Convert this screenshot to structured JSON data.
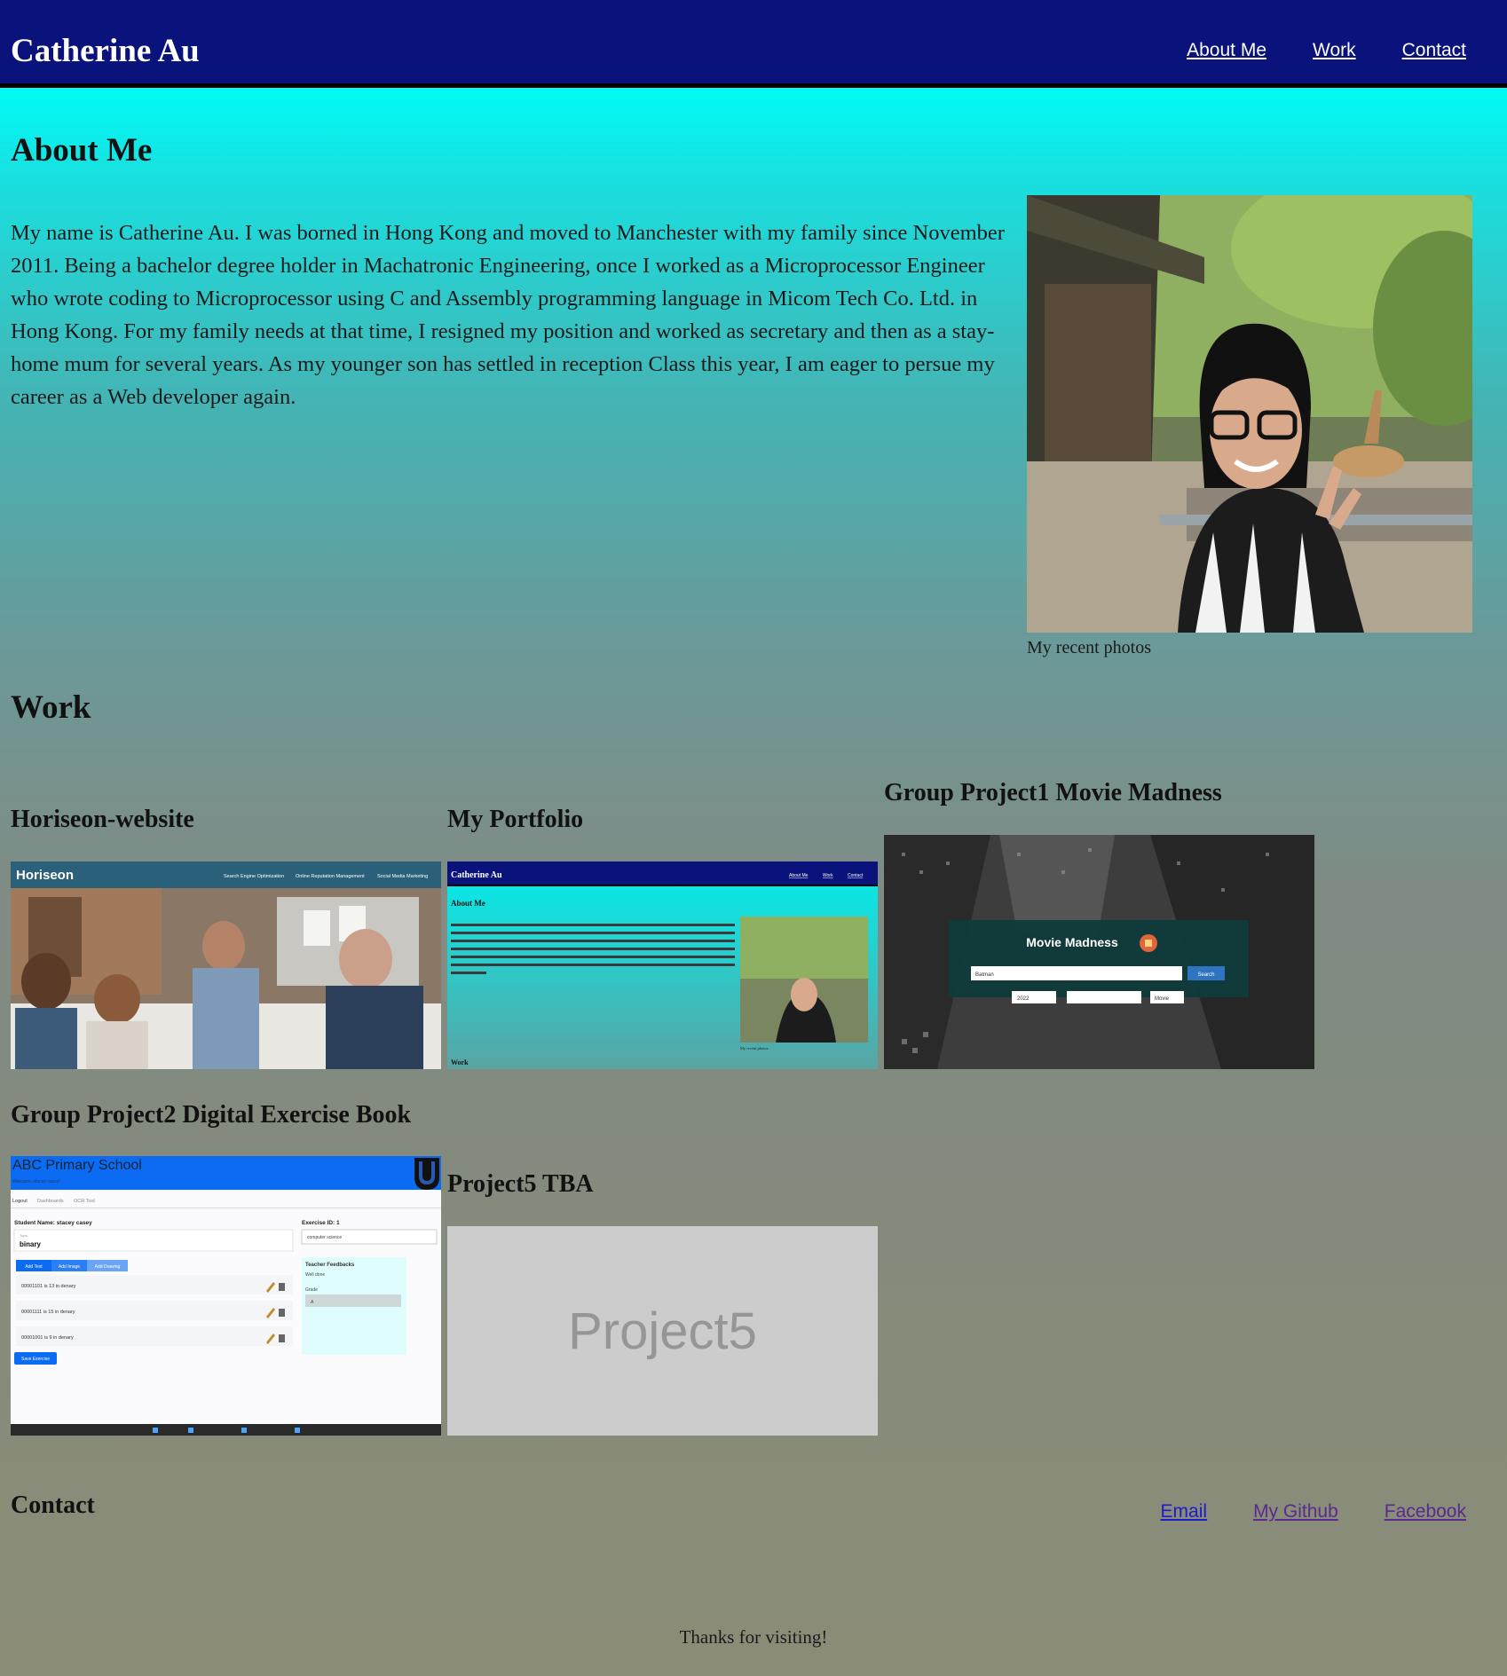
{
  "header": {
    "title": "Catherine Au",
    "nav": [
      {
        "label": "About Me"
      },
      {
        "label": "Work"
      },
      {
        "label": "Contact"
      }
    ]
  },
  "about": {
    "heading": "About Me",
    "text": "My name is Catherine Au. I was borned in Hong Kong and moved to Manchester with my family since November 2011. Being a bachelor degree holder in Machatronic Engineering, once I worked as a Microprocessor Engineer who wrote coding to Microprocessor using C and Assembly programming language in Micom Tech Co. Ltd. in Hong Kong. For my family needs at that time, I resigned my position and worked as secretary and then as a stay-home mum for several years. As my younger son has settled in reception Class this year, I am eager to persue my career as a Web developer again.",
    "photo_caption": "My recent photos"
  },
  "work": {
    "heading": "Work",
    "projects": [
      {
        "title": "Horiseon-website",
        "thumb": {
          "brand": "Horiseon",
          "nav": [
            "Search Engine Optimization",
            "Online Reputation Management",
            "Social Media Marketing"
          ]
        }
      },
      {
        "title": "My Portfolio",
        "thumb": {
          "brand": "Catherine Au",
          "nav": [
            "About Me",
            "Work",
            "Contact"
          ],
          "heading": "About Me",
          "caption": "My recent photos",
          "work": "Work"
        }
      },
      {
        "title": "Group Project1 Movie Madness",
        "thumb": {
          "app": "Movie Madness",
          "search_value": "Batman",
          "search_button": "Search",
          "year_value": "2022",
          "type_value": "Movie"
        }
      },
      {
        "title": "Group Project2 Digital Exercise Book",
        "thumb": {
          "school": "ABC Primary School",
          "welcome": "Welcome, stacey casey!",
          "tabs": [
            "Logout",
            "Dashboards",
            "OCR Tool"
          ],
          "student": "Student Name: stacey casey",
          "topic_label": "Topic",
          "topic": "binary",
          "exercise": "Exercise ID: 1",
          "subject": "computer science",
          "buttons": [
            "Add Text",
            "Add Image",
            "Add Drawing"
          ],
          "items": [
            "00001101 is 13 in denary",
            "00001111 is 15 in denary",
            "00001001 is 9 in denary"
          ],
          "feedback_title": "Teacher Feedbacks",
          "feedback": "Well done",
          "grade_label": "Grade",
          "grade": "A",
          "save": "Save Exercise"
        }
      },
      {
        "title": "Project5 TBA",
        "thumb": {
          "placeholder": "Project5"
        }
      }
    ]
  },
  "contact": {
    "heading": "Contact",
    "links": [
      {
        "label": "Email"
      },
      {
        "label": "My Github"
      },
      {
        "label": "Facebook"
      }
    ]
  },
  "footer": {
    "text": "Thanks for visiting!"
  },
  "colors": {
    "header_bg": "#0a137c",
    "gradient_top": "#00fcf7",
    "gradient_bottom": "#8a8c76",
    "link": "#1c1ccf",
    "link_visited": "#5a2a8f"
  }
}
